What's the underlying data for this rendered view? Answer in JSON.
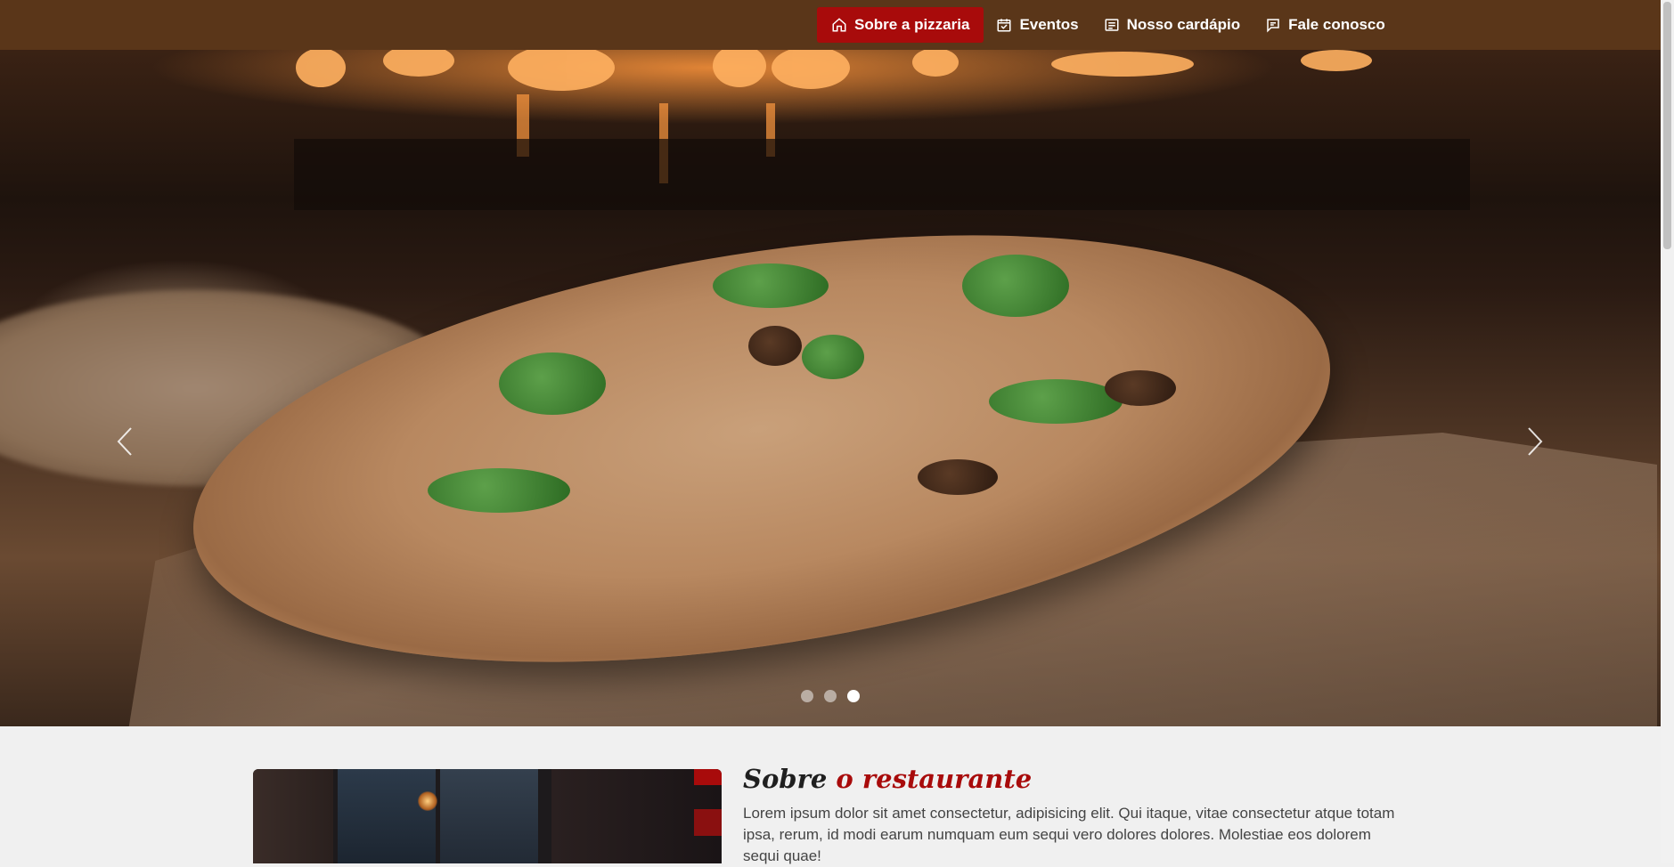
{
  "nav": {
    "items": [
      {
        "label": "Sobre a pizzaria",
        "icon": "home-icon",
        "active": true
      },
      {
        "label": "Eventos",
        "icon": "calendar-check-icon",
        "active": false
      },
      {
        "label": "Nosso cardápio",
        "icon": "menu-card-icon",
        "active": false
      },
      {
        "label": "Fale conosco",
        "icon": "chat-icon",
        "active": false
      }
    ]
  },
  "carousel": {
    "image": "wood-fired-pizza-on-peel",
    "slide_count": 3,
    "active_slide": 3,
    "prev_icon": "chevron-left-icon",
    "next_icon": "chevron-right-icon"
  },
  "about": {
    "title_part1": "Sobre",
    "title_part2": "o restaurante",
    "text": "Lorem ipsum dolor sit amet consectetur, adipisicing elit. Qui itaque, vitae consectetur atque totam ipsa, rerum, id modi earum numquam eum sequi vero dolores dolores. Molestiae eos dolorem sequi quae!",
    "image": "restaurant-interior"
  },
  "colors": {
    "navbar": "#5a3619",
    "accent": "#a80b0b",
    "background": "#f0f0f0"
  }
}
